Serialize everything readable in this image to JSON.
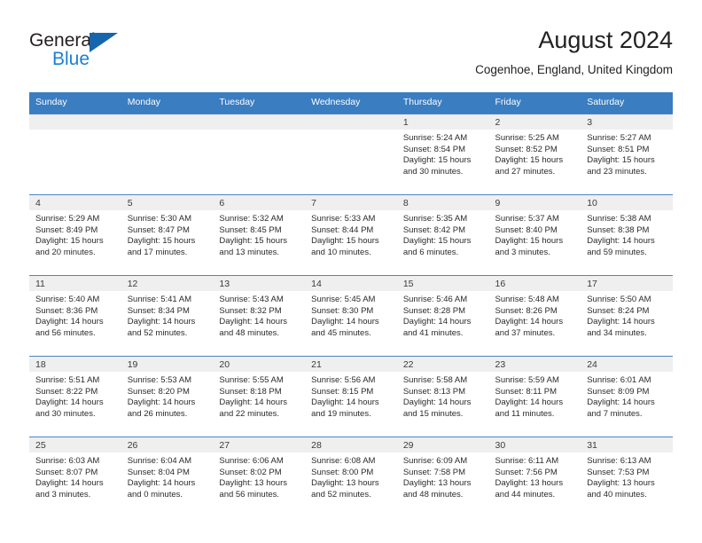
{
  "brand": {
    "name_part1": "General",
    "name_part2": "Blue",
    "logo_icon": "triangle-logo-icon"
  },
  "header": {
    "title": "August 2024",
    "location": "Cogenhoe, England, United Kingdom"
  },
  "colors": {
    "header_blue": "#3a7dc0",
    "daynum_band": "#efefef",
    "brand_blue": "#1a7fd4",
    "logo_blue": "#1566ac",
    "text": "#222222"
  },
  "calendar": {
    "weekday_headers": [
      "Sunday",
      "Monday",
      "Tuesday",
      "Wednesday",
      "Thursday",
      "Friday",
      "Saturday"
    ],
    "labels": {
      "sunrise": "Sunrise:",
      "sunset": "Sunset:",
      "daylight": "Daylight:"
    },
    "weeks": [
      [
        {
          "day": "",
          "empty": true
        },
        {
          "day": "",
          "empty": true
        },
        {
          "day": "",
          "empty": true
        },
        {
          "day": "",
          "empty": true
        },
        {
          "day": "1",
          "sunrise": "Sunrise: 5:24 AM",
          "sunset": "Sunset: 8:54 PM",
          "daylight_1": "Daylight: 15 hours",
          "daylight_2": "and 30 minutes."
        },
        {
          "day": "2",
          "sunrise": "Sunrise: 5:25 AM",
          "sunset": "Sunset: 8:52 PM",
          "daylight_1": "Daylight: 15 hours",
          "daylight_2": "and 27 minutes."
        },
        {
          "day": "3",
          "sunrise": "Sunrise: 5:27 AM",
          "sunset": "Sunset: 8:51 PM",
          "daylight_1": "Daylight: 15 hours",
          "daylight_2": "and 23 minutes."
        }
      ],
      [
        {
          "day": "4",
          "sunrise": "Sunrise: 5:29 AM",
          "sunset": "Sunset: 8:49 PM",
          "daylight_1": "Daylight: 15 hours",
          "daylight_2": "and 20 minutes."
        },
        {
          "day": "5",
          "sunrise": "Sunrise: 5:30 AM",
          "sunset": "Sunset: 8:47 PM",
          "daylight_1": "Daylight: 15 hours",
          "daylight_2": "and 17 minutes."
        },
        {
          "day": "6",
          "sunrise": "Sunrise: 5:32 AM",
          "sunset": "Sunset: 8:45 PM",
          "daylight_1": "Daylight: 15 hours",
          "daylight_2": "and 13 minutes."
        },
        {
          "day": "7",
          "sunrise": "Sunrise: 5:33 AM",
          "sunset": "Sunset: 8:44 PM",
          "daylight_1": "Daylight: 15 hours",
          "daylight_2": "and 10 minutes."
        },
        {
          "day": "8",
          "sunrise": "Sunrise: 5:35 AM",
          "sunset": "Sunset: 8:42 PM",
          "daylight_1": "Daylight: 15 hours",
          "daylight_2": "and 6 minutes."
        },
        {
          "day": "9",
          "sunrise": "Sunrise: 5:37 AM",
          "sunset": "Sunset: 8:40 PM",
          "daylight_1": "Daylight: 15 hours",
          "daylight_2": "and 3 minutes."
        },
        {
          "day": "10",
          "sunrise": "Sunrise: 5:38 AM",
          "sunset": "Sunset: 8:38 PM",
          "daylight_1": "Daylight: 14 hours",
          "daylight_2": "and 59 minutes."
        }
      ],
      [
        {
          "day": "11",
          "sunrise": "Sunrise: 5:40 AM",
          "sunset": "Sunset: 8:36 PM",
          "daylight_1": "Daylight: 14 hours",
          "daylight_2": "and 56 minutes."
        },
        {
          "day": "12",
          "sunrise": "Sunrise: 5:41 AM",
          "sunset": "Sunset: 8:34 PM",
          "daylight_1": "Daylight: 14 hours",
          "daylight_2": "and 52 minutes."
        },
        {
          "day": "13",
          "sunrise": "Sunrise: 5:43 AM",
          "sunset": "Sunset: 8:32 PM",
          "daylight_1": "Daylight: 14 hours",
          "daylight_2": "and 48 minutes."
        },
        {
          "day": "14",
          "sunrise": "Sunrise: 5:45 AM",
          "sunset": "Sunset: 8:30 PM",
          "daylight_1": "Daylight: 14 hours",
          "daylight_2": "and 45 minutes."
        },
        {
          "day": "15",
          "sunrise": "Sunrise: 5:46 AM",
          "sunset": "Sunset: 8:28 PM",
          "daylight_1": "Daylight: 14 hours",
          "daylight_2": "and 41 minutes."
        },
        {
          "day": "16",
          "sunrise": "Sunrise: 5:48 AM",
          "sunset": "Sunset: 8:26 PM",
          "daylight_1": "Daylight: 14 hours",
          "daylight_2": "and 37 minutes."
        },
        {
          "day": "17",
          "sunrise": "Sunrise: 5:50 AM",
          "sunset": "Sunset: 8:24 PM",
          "daylight_1": "Daylight: 14 hours",
          "daylight_2": "and 34 minutes."
        }
      ],
      [
        {
          "day": "18",
          "sunrise": "Sunrise: 5:51 AM",
          "sunset": "Sunset: 8:22 PM",
          "daylight_1": "Daylight: 14 hours",
          "daylight_2": "and 30 minutes."
        },
        {
          "day": "19",
          "sunrise": "Sunrise: 5:53 AM",
          "sunset": "Sunset: 8:20 PM",
          "daylight_1": "Daylight: 14 hours",
          "daylight_2": "and 26 minutes."
        },
        {
          "day": "20",
          "sunrise": "Sunrise: 5:55 AM",
          "sunset": "Sunset: 8:18 PM",
          "daylight_1": "Daylight: 14 hours",
          "daylight_2": "and 22 minutes."
        },
        {
          "day": "21",
          "sunrise": "Sunrise: 5:56 AM",
          "sunset": "Sunset: 8:15 PM",
          "daylight_1": "Daylight: 14 hours",
          "daylight_2": "and 19 minutes."
        },
        {
          "day": "22",
          "sunrise": "Sunrise: 5:58 AM",
          "sunset": "Sunset: 8:13 PM",
          "daylight_1": "Daylight: 14 hours",
          "daylight_2": "and 15 minutes."
        },
        {
          "day": "23",
          "sunrise": "Sunrise: 5:59 AM",
          "sunset": "Sunset: 8:11 PM",
          "daylight_1": "Daylight: 14 hours",
          "daylight_2": "and 11 minutes."
        },
        {
          "day": "24",
          "sunrise": "Sunrise: 6:01 AM",
          "sunset": "Sunset: 8:09 PM",
          "daylight_1": "Daylight: 14 hours",
          "daylight_2": "and 7 minutes."
        }
      ],
      [
        {
          "day": "25",
          "sunrise": "Sunrise: 6:03 AM",
          "sunset": "Sunset: 8:07 PM",
          "daylight_1": "Daylight: 14 hours",
          "daylight_2": "and 3 minutes."
        },
        {
          "day": "26",
          "sunrise": "Sunrise: 6:04 AM",
          "sunset": "Sunset: 8:04 PM",
          "daylight_1": "Daylight: 14 hours",
          "daylight_2": "and 0 minutes."
        },
        {
          "day": "27",
          "sunrise": "Sunrise: 6:06 AM",
          "sunset": "Sunset: 8:02 PM",
          "daylight_1": "Daylight: 13 hours",
          "daylight_2": "and 56 minutes."
        },
        {
          "day": "28",
          "sunrise": "Sunrise: 6:08 AM",
          "sunset": "Sunset: 8:00 PM",
          "daylight_1": "Daylight: 13 hours",
          "daylight_2": "and 52 minutes."
        },
        {
          "day": "29",
          "sunrise": "Sunrise: 6:09 AM",
          "sunset": "Sunset: 7:58 PM",
          "daylight_1": "Daylight: 13 hours",
          "daylight_2": "and 48 minutes."
        },
        {
          "day": "30",
          "sunrise": "Sunrise: 6:11 AM",
          "sunset": "Sunset: 7:56 PM",
          "daylight_1": "Daylight: 13 hours",
          "daylight_2": "and 44 minutes."
        },
        {
          "day": "31",
          "sunrise": "Sunrise: 6:13 AM",
          "sunset": "Sunset: 7:53 PM",
          "daylight_1": "Daylight: 13 hours",
          "daylight_2": "and 40 minutes."
        }
      ]
    ]
  }
}
